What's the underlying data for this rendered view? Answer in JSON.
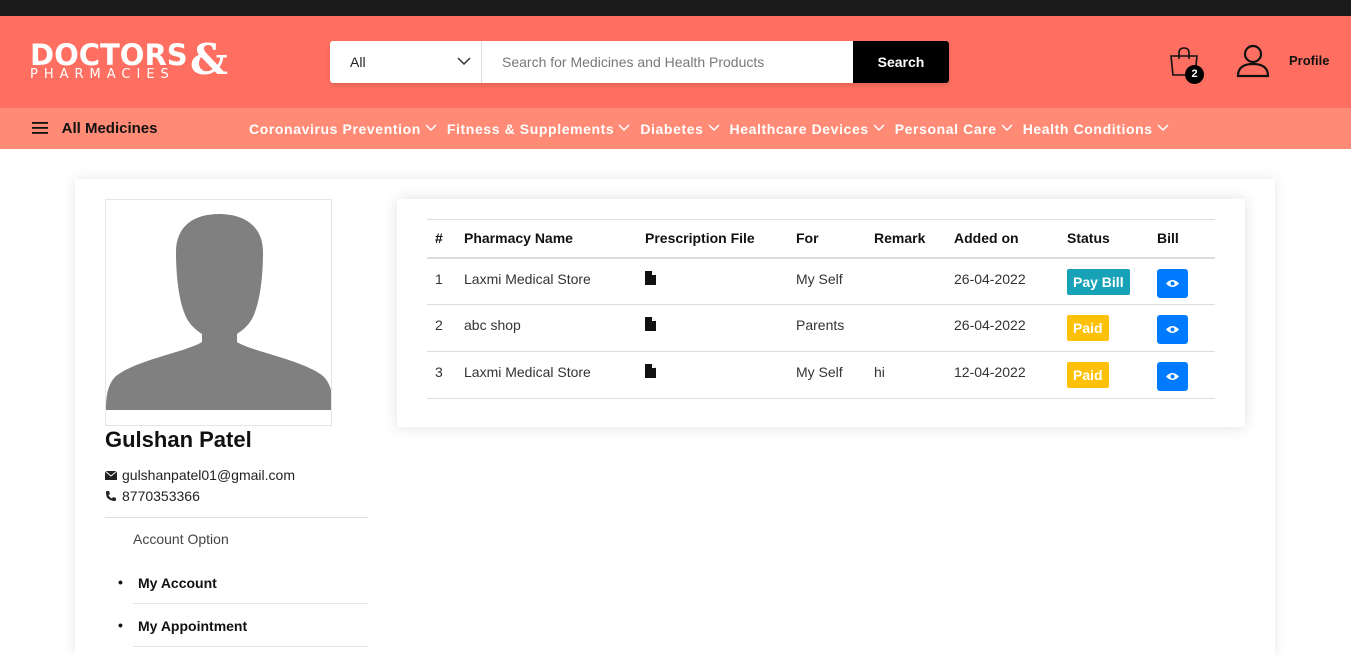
{
  "brand": {
    "line1": "DOCTORS",
    "line2": "PHARMACIES",
    "amp": "&"
  },
  "search": {
    "category": "All",
    "placeholder": "Search for Medicines and Health Products",
    "button": "Search"
  },
  "header": {
    "cart_count": "2",
    "profile_label": "Profile"
  },
  "nav": {
    "all_medicines": "All Medicines",
    "links": [
      "Coronavirus Prevention",
      "Fitness & Supplements",
      "Diabetes",
      "Healthcare Devices",
      "Personal Care",
      "Health Conditions"
    ]
  },
  "user": {
    "name": "Gulshan Patel",
    "email": "gulshanpatel01@gmail.com",
    "phone": "8770353366"
  },
  "account": {
    "heading": "Account Option",
    "menu": [
      "My Account",
      "My Appointment"
    ]
  },
  "table": {
    "headers": [
      "#",
      "Pharmacy Name",
      "Prescription File",
      "For",
      "Remark",
      "Added on",
      "Status",
      "Bill"
    ],
    "rows": [
      {
        "num": "1",
        "pharmacy": "Laxmi Medical Store",
        "for": "My Self",
        "remark": "",
        "added": "26-04-2022",
        "status": "Pay Bill"
      },
      {
        "num": "2",
        "pharmacy": "abc shop",
        "for": "Parents",
        "remark": "",
        "added": "26-04-2022",
        "status": "Paid"
      },
      {
        "num": "3",
        "pharmacy": "Laxmi Medical Store",
        "for": "My Self",
        "remark": "hi",
        "added": "12-04-2022",
        "status": "Paid"
      }
    ]
  },
  "icons": {
    "logo": "brand-logo",
    "chevron": "chevron-down-icon",
    "cart": "shopping-bag-icon",
    "user": "user-icon",
    "menu": "hamburger-icon",
    "email": "envelope-icon",
    "phone": "phone-icon",
    "file": "file-icon",
    "eye": "eye-icon"
  },
  "colors": {
    "header": "#fe6f61",
    "nav": "#ff8a75",
    "pay_bill": "#17a2b8",
    "paid": "#ffc107",
    "view": "#007bff"
  }
}
